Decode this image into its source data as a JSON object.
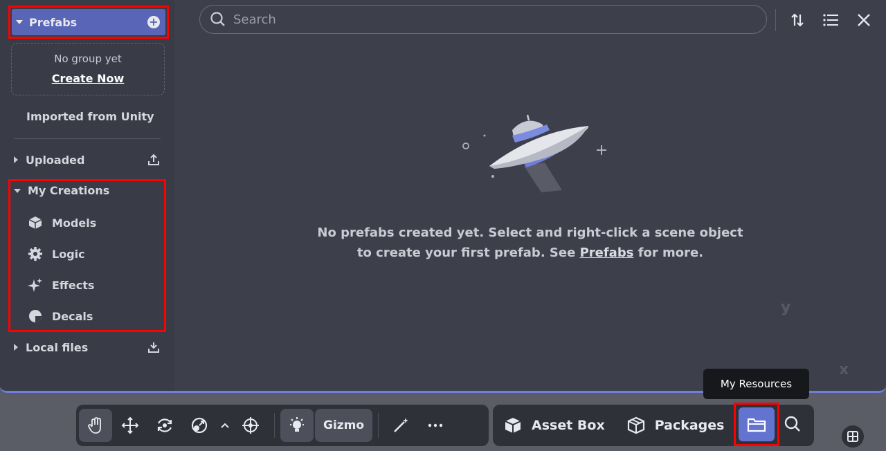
{
  "sidebar": {
    "prefabs_label": "Prefabs",
    "no_group_text": "No group yet",
    "create_now_label": "Create Now",
    "imported_label": "Imported from Unity",
    "uploaded_label": "Uploaded",
    "my_creations_label": "My Creations",
    "models_label": "Models",
    "logic_label": "Logic",
    "effects_label": "Effects",
    "decals_label": "Decals",
    "local_files_label": "Local files"
  },
  "search": {
    "placeholder": "Search"
  },
  "empty_state": {
    "line1": "No prefabs created yet. Select and right-click a scene object",
    "line2_pre": "to create your first prefab. See ",
    "line2_link": "Prefabs",
    "line2_post": " for more."
  },
  "tooltip": {
    "text": "My Resources"
  },
  "toolbar": {
    "gizmo_label": "Gizmo"
  },
  "right_bar": {
    "asset_box_label": "Asset Box",
    "packages_label": "Packages"
  },
  "axes": {
    "y": "y",
    "x": "x"
  },
  "colors": {
    "accent": "#5966b8",
    "highlight": "#ff0000",
    "active_resource": "#6373d0"
  },
  "icons": [
    "plus-circle-icon",
    "upload-icon",
    "cube-icon",
    "gear-icon",
    "sparkle-icon",
    "decal-icon",
    "download-icon",
    "search-icon",
    "sort-icon",
    "list-icon",
    "close-icon",
    "hand-icon",
    "move-icon",
    "rotate-icon",
    "scale-icon",
    "chevron-up-icon",
    "transform-icon",
    "lightbulb-icon",
    "magic-wand-icon",
    "more-icon",
    "asset-box-icon",
    "packages-icon",
    "folder-icon",
    "grid-icon"
  ]
}
